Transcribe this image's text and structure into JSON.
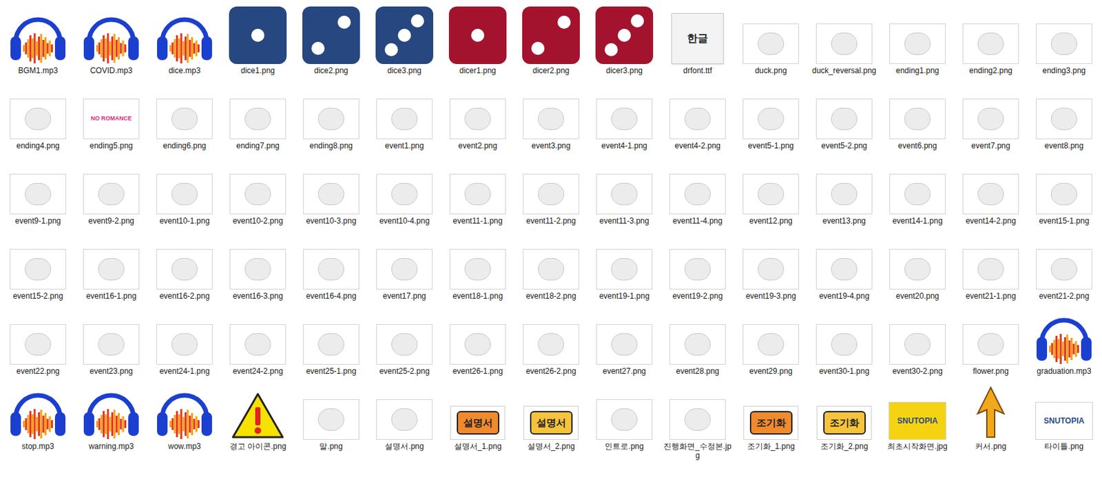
{
  "view": "file-icons",
  "items": [
    {
      "name": "BGM1.mp3",
      "kind": "audio"
    },
    {
      "name": "COVID.mp3",
      "kind": "audio"
    },
    {
      "name": "dice.mp3",
      "kind": "audio"
    },
    {
      "name": "dice1.png",
      "kind": "dice",
      "pips": 1,
      "color": "#26477f"
    },
    {
      "name": "dice2.png",
      "kind": "dice",
      "pips": 2,
      "color": "#26477f"
    },
    {
      "name": "dice3.png",
      "kind": "dice",
      "pips": 3,
      "color": "#26477f"
    },
    {
      "name": "dicer1.png",
      "kind": "dice",
      "pips": 1,
      "color": "#a3132d"
    },
    {
      "name": "dicer2.png",
      "kind": "dice",
      "pips": 2,
      "color": "#a3132d"
    },
    {
      "name": "dicer3.png",
      "kind": "dice",
      "pips": 3,
      "color": "#a3132d"
    },
    {
      "name": "drfont.ttf",
      "kind": "font",
      "thumb_text": "한글"
    },
    {
      "name": "duck.png",
      "kind": "image"
    },
    {
      "name": "duck_reversal.png",
      "kind": "image"
    },
    {
      "name": "ending1.png",
      "kind": "image"
    },
    {
      "name": "ending2.png",
      "kind": "image"
    },
    {
      "name": "ending3.png",
      "kind": "image"
    },
    {
      "name": "ending4.png",
      "kind": "image"
    },
    {
      "name": "ending5.png",
      "kind": "image",
      "thumb_text": "NO ROMANCE"
    },
    {
      "name": "ending6.png",
      "kind": "image"
    },
    {
      "name": "ending7.png",
      "kind": "image"
    },
    {
      "name": "ending8.png",
      "kind": "image"
    },
    {
      "name": "event1.png",
      "kind": "image"
    },
    {
      "name": "event2.png",
      "kind": "image"
    },
    {
      "name": "event3.png",
      "kind": "image"
    },
    {
      "name": "event4-1.png",
      "kind": "image"
    },
    {
      "name": "event4-2.png",
      "kind": "image"
    },
    {
      "name": "event5-1.png",
      "kind": "image"
    },
    {
      "name": "event5-2.png",
      "kind": "image"
    },
    {
      "name": "event6.png",
      "kind": "image"
    },
    {
      "name": "event7.png",
      "kind": "image"
    },
    {
      "name": "event8.png",
      "kind": "image"
    },
    {
      "name": "event9-1.png",
      "kind": "image"
    },
    {
      "name": "event9-2.png",
      "kind": "image"
    },
    {
      "name": "event10-1.png",
      "kind": "image"
    },
    {
      "name": "event10-2.png",
      "kind": "image"
    },
    {
      "name": "event10-3.png",
      "kind": "image"
    },
    {
      "name": "event10-4.png",
      "kind": "image"
    },
    {
      "name": "event11-1.png",
      "kind": "image"
    },
    {
      "name": "event11-2.png",
      "kind": "image"
    },
    {
      "name": "event11-3.png",
      "kind": "image"
    },
    {
      "name": "event11-4.png",
      "kind": "image"
    },
    {
      "name": "event12.png",
      "kind": "image"
    },
    {
      "name": "event13.png",
      "kind": "image"
    },
    {
      "name": "event14-1.png",
      "kind": "image"
    },
    {
      "name": "event14-2.png",
      "kind": "image"
    },
    {
      "name": "event15-1.png",
      "kind": "image"
    },
    {
      "name": "event15-2.png",
      "kind": "image"
    },
    {
      "name": "event16-1.png",
      "kind": "image"
    },
    {
      "name": "event16-2.png",
      "kind": "image"
    },
    {
      "name": "event16-3.png",
      "kind": "image"
    },
    {
      "name": "event16-4.png",
      "kind": "image"
    },
    {
      "name": "event17.png",
      "kind": "image"
    },
    {
      "name": "event18-1.png",
      "kind": "image"
    },
    {
      "name": "event18-2.png",
      "kind": "image"
    },
    {
      "name": "event19-1.png",
      "kind": "image"
    },
    {
      "name": "event19-2.png",
      "kind": "image"
    },
    {
      "name": "event19-3.png",
      "kind": "image"
    },
    {
      "name": "event19-4.png",
      "kind": "image"
    },
    {
      "name": "event20.png",
      "kind": "image"
    },
    {
      "name": "event21-1.png",
      "kind": "image"
    },
    {
      "name": "event21-2.png",
      "kind": "image"
    },
    {
      "name": "event22.png",
      "kind": "image"
    },
    {
      "name": "event23.png",
      "kind": "image"
    },
    {
      "name": "event24-1.png",
      "kind": "image"
    },
    {
      "name": "event24-2.png",
      "kind": "image"
    },
    {
      "name": "event25-1.png",
      "kind": "image"
    },
    {
      "name": "event25-2.png",
      "kind": "image"
    },
    {
      "name": "event26-1.png",
      "kind": "image"
    },
    {
      "name": "event26-2.png",
      "kind": "image"
    },
    {
      "name": "event27.png",
      "kind": "image"
    },
    {
      "name": "event28.png",
      "kind": "image"
    },
    {
      "name": "event29.png",
      "kind": "image"
    },
    {
      "name": "event30-1.png",
      "kind": "image"
    },
    {
      "name": "event30-2.png",
      "kind": "image"
    },
    {
      "name": "flower.png",
      "kind": "image"
    },
    {
      "name": "graduation.mp3",
      "kind": "audio"
    },
    {
      "name": "stop.mp3",
      "kind": "audio"
    },
    {
      "name": "warning.mp3",
      "kind": "audio"
    },
    {
      "name": "wow.mp3",
      "kind": "audio"
    },
    {
      "name": "경고 아이콘.png",
      "kind": "warning"
    },
    {
      "name": "말.png",
      "kind": "image"
    },
    {
      "name": "설명서.png",
      "kind": "image"
    },
    {
      "name": "설명서_1.png",
      "kind": "label",
      "thumb_text": "설명서",
      "color": "#f08a2c"
    },
    {
      "name": "설명서_2.png",
      "kind": "label",
      "thumb_text": "설명서",
      "color": "#f6c33a"
    },
    {
      "name": "인트로.png",
      "kind": "image"
    },
    {
      "name": "진행화면_수정본.jpg",
      "kind": "image"
    },
    {
      "name": "조기화_1.png",
      "kind": "label",
      "thumb_text": "조기화",
      "color": "#f08a2c"
    },
    {
      "name": "조기화_2.png",
      "kind": "label",
      "thumb_text": "조기화",
      "color": "#f6c33a"
    },
    {
      "name": "최초시작화면.jpg",
      "kind": "banner",
      "thumb_text": "SNUTOPIA",
      "color": "#f5d312"
    },
    {
      "name": "커서.png",
      "kind": "cursor"
    },
    {
      "name": "타이틀.png",
      "kind": "banner",
      "thumb_text": "SNUTOPIA",
      "color": "#ffffff"
    }
  ]
}
